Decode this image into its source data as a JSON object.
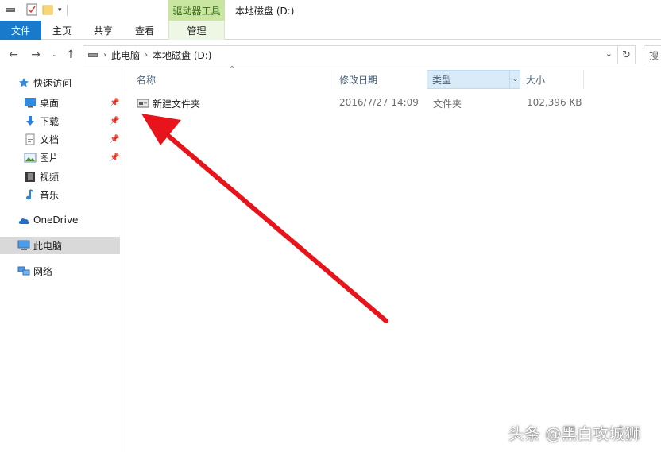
{
  "window": {
    "title": "本地磁盘 (D:)",
    "context_tab": "驱动器工具"
  },
  "ribbon": {
    "tabs": [
      {
        "label": "文件"
      },
      {
        "label": "主页"
      },
      {
        "label": "共享"
      },
      {
        "label": "查看"
      },
      {
        "label": "管理"
      }
    ]
  },
  "address": {
    "breadcrumbs": [
      "此电脑",
      "本地磁盘 (D:)"
    ],
    "search_label": "搜"
  },
  "nav": {
    "quick_access": "快速访问",
    "items": [
      {
        "label": "桌面",
        "icon": "desktop-icon",
        "pinned": true
      },
      {
        "label": "下载",
        "icon": "download-icon",
        "pinned": true
      },
      {
        "label": "文档",
        "icon": "document-icon",
        "pinned": true
      },
      {
        "label": "图片",
        "icon": "pictures-icon",
        "pinned": true
      },
      {
        "label": "视频",
        "icon": "videos-icon",
        "pinned": false
      },
      {
        "label": "音乐",
        "icon": "music-icon",
        "pinned": false
      }
    ],
    "onedrive": "OneDrive",
    "this_pc": "此电脑",
    "network": "网络"
  },
  "columns": {
    "name": "名称",
    "modified": "修改日期",
    "type": "类型",
    "size": "大小"
  },
  "files": [
    {
      "name": "新建文件夹",
      "modified": "2016/7/27 14:09",
      "type": "文件夹",
      "size": "102,396 KB"
    }
  ],
  "watermark": "头条 @黑白攻城狮",
  "colors": {
    "file_tab": "#1979ca",
    "drive_tools": "#c8e6a0",
    "arrow": "#e8141b",
    "selected": "#d9d9d9"
  }
}
